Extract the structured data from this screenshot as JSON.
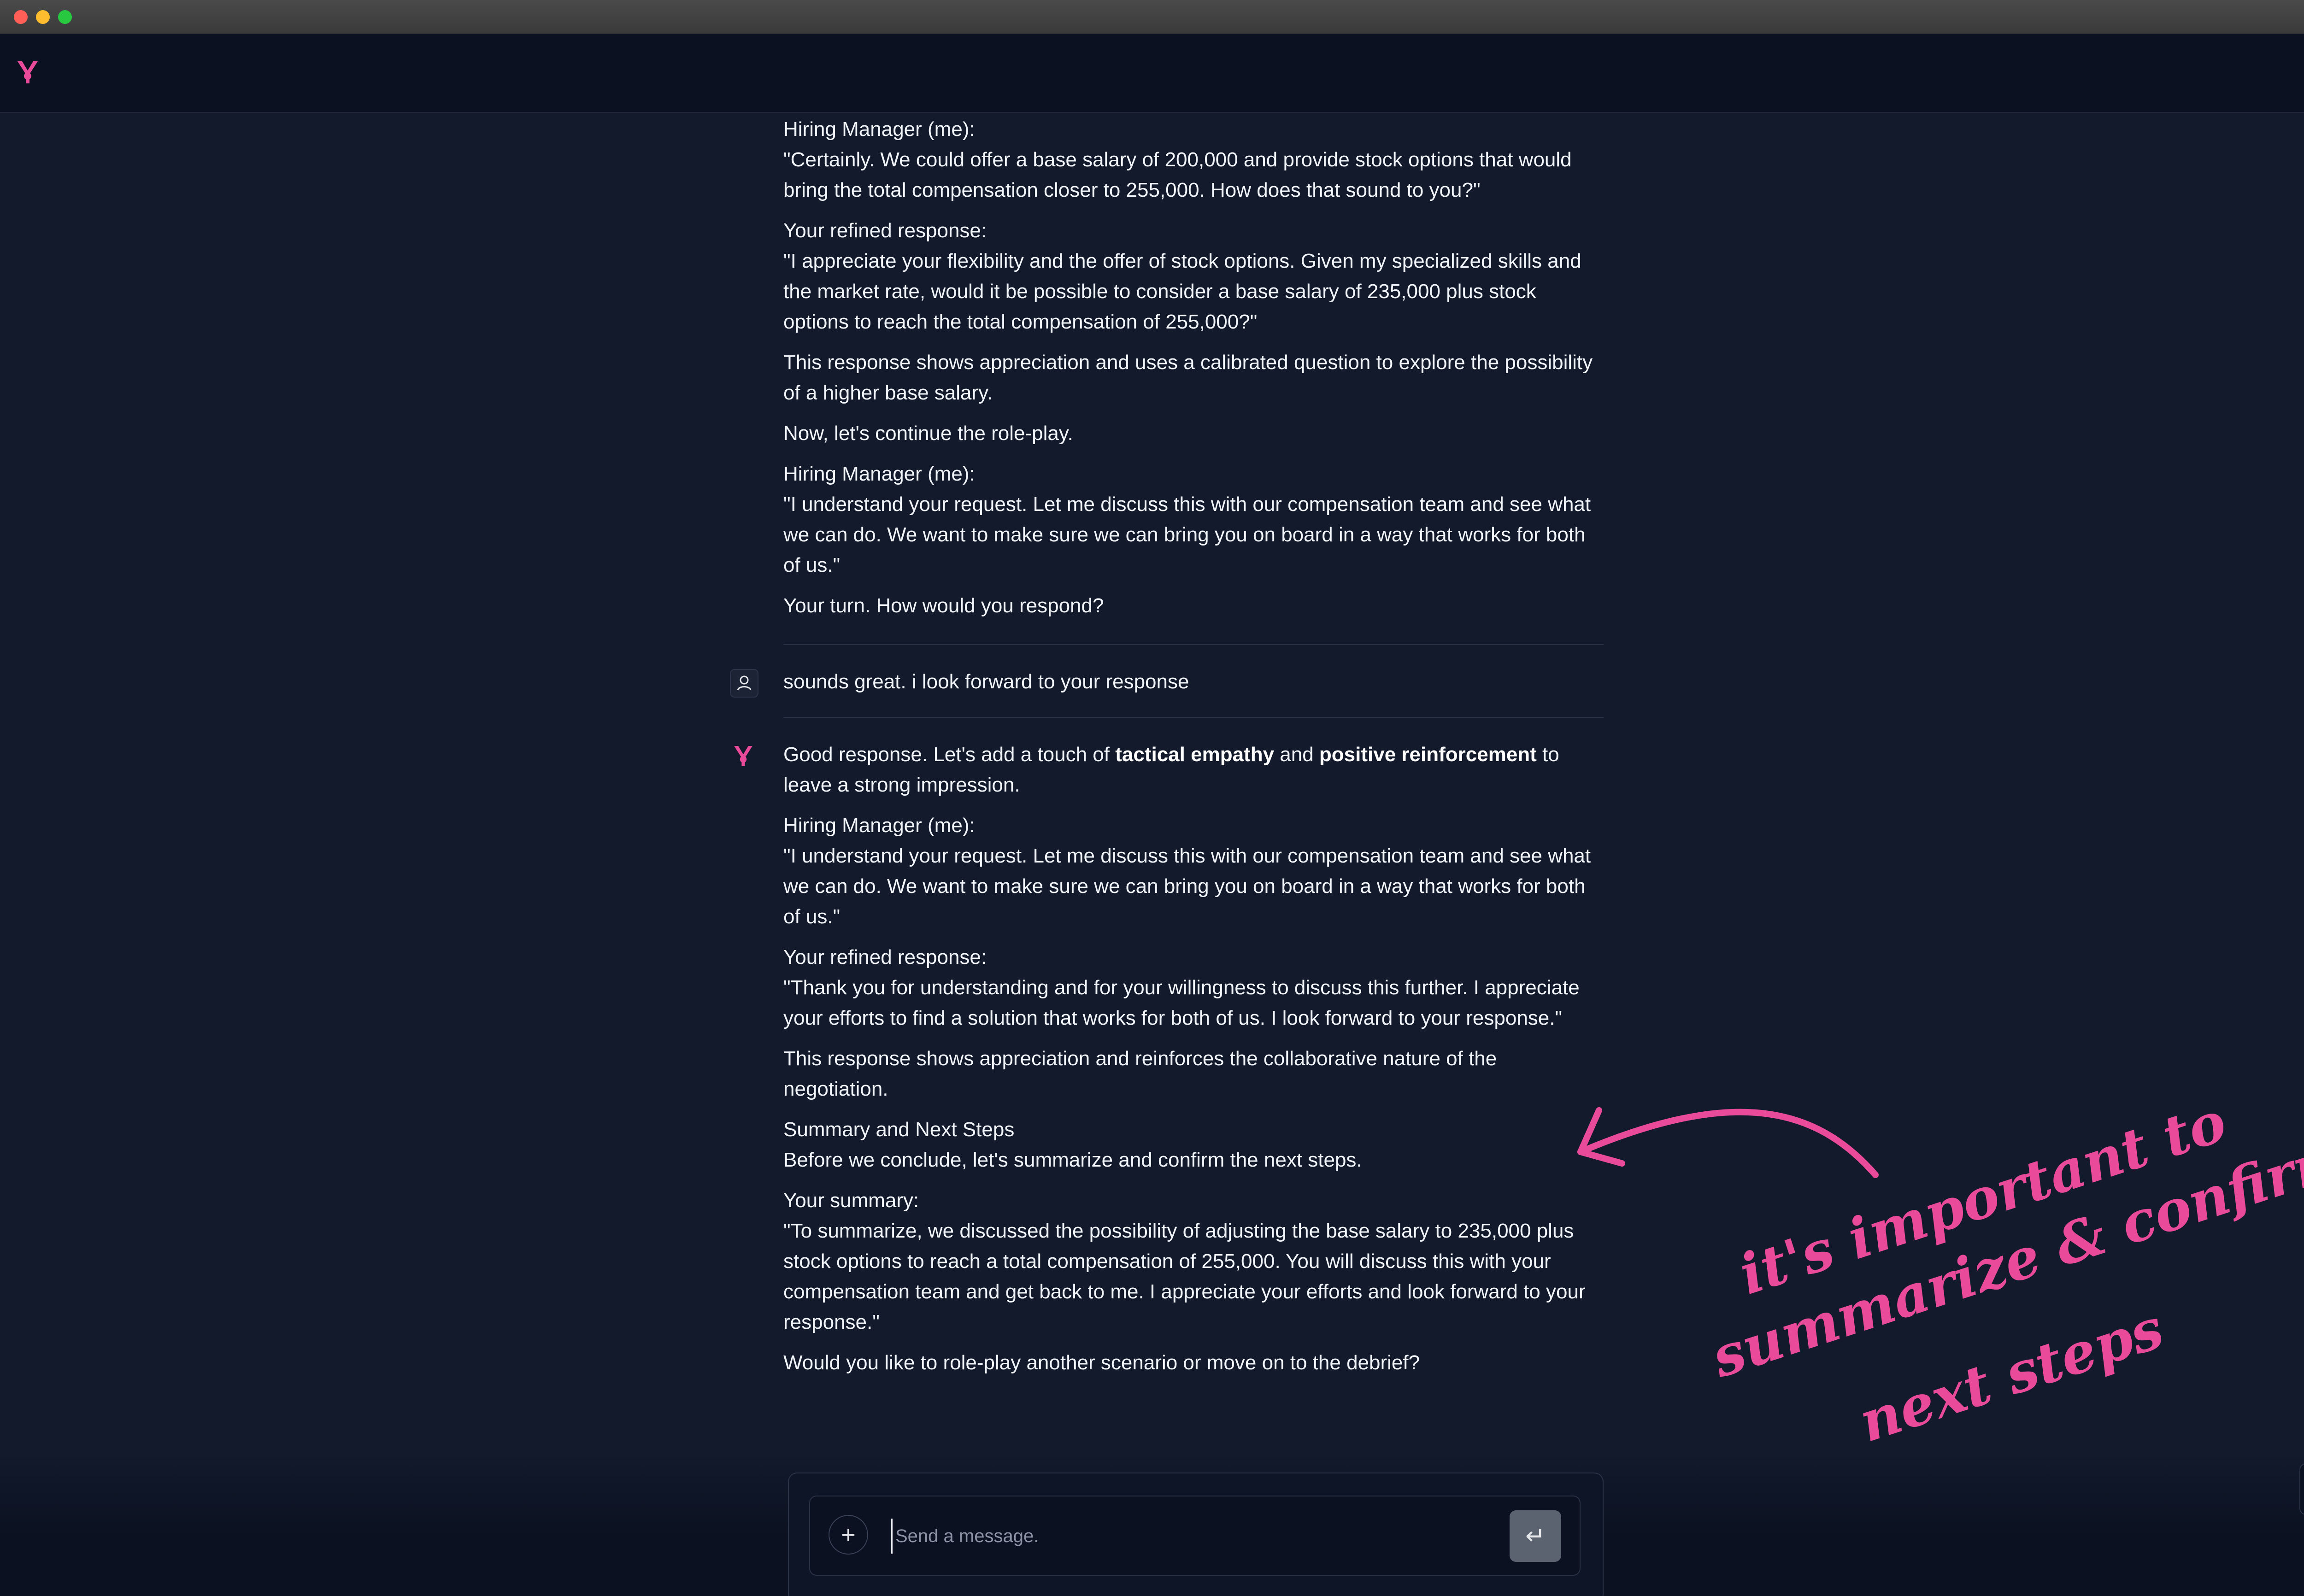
{
  "window": {
    "traffic_lights": [
      "close",
      "minimize",
      "maximize"
    ]
  },
  "header": {
    "logo_icon": "brand-logo-icon",
    "avatar_icon": "user-avatar"
  },
  "earlier_ai_message": {
    "paragraphs": [
      "Hiring Manager (me):\n\"Certainly. We could offer a base salary of 200,000 and provide stock options that would bring the total compensation closer to 255,000. How does that sound to you?\"",
      "Your refined response:\n\"I appreciate your flexibility and the offer of stock options. Given my specialized skills and the market rate, would it be possible to consider a base salary of 235,000 plus stock options to reach the total compensation of 255,000?\"",
      "This response shows appreciation and uses a calibrated question to explore the possibility of a higher base salary.",
      "Now, let's continue the role-play.",
      "Hiring Manager (me):\n\"I understand your request. Let me discuss this with our compensation team and see what we can do. We want to make sure we can bring you on board in a way that works for both of us.\"",
      "Your turn. How would you respond?"
    ]
  },
  "user_message": {
    "text": "sounds great. i look forward to your response",
    "icon": "user-icon"
  },
  "latest_ai_message": {
    "icon": "ai-logo-icon",
    "intro_prefix": "Good response. Let's add a touch of ",
    "intro_bold_1": "tactical empathy",
    "intro_mid": " and ",
    "intro_bold_2": "positive reinforcement",
    "intro_suffix": " to leave a strong impression.",
    "paragraphs": [
      "Hiring Manager (me):\n\"I understand your request. Let me discuss this with our compensation team and see what we can do. We want to make sure we can bring you on board in a way that works for both of us.\"",
      "Your refined response:\n\"Thank you for understanding and for your willingness to discuss this further. I appreciate your efforts to find a solution that works for both of us. I look forward to your response.\"",
      "This response shows appreciation and reinforces the collaborative nature of the negotiation.",
      "Summary and Next Steps\nBefore we conclude, let's summarize and confirm the next steps.",
      "Your summary:\n\"To summarize, we discussed the possibility of adjusting the base salary to 235,000 plus stock options to reach a total compensation of 255,000. You will discuss this with your compensation team and get back to me. I appreciate your efforts and look forward to your response.\"",
      "Would you like to role-play another scenario or move on to the debrief?"
    ]
  },
  "composer": {
    "placeholder": "Send a message.",
    "add_label": "+",
    "send_label": "↵"
  },
  "scroll_button": {
    "label": "↓"
  },
  "annotation": {
    "line1": "it's important to",
    "line2": "summarize & confirm",
    "line3": "next steps",
    "color": "#e94a9a"
  }
}
